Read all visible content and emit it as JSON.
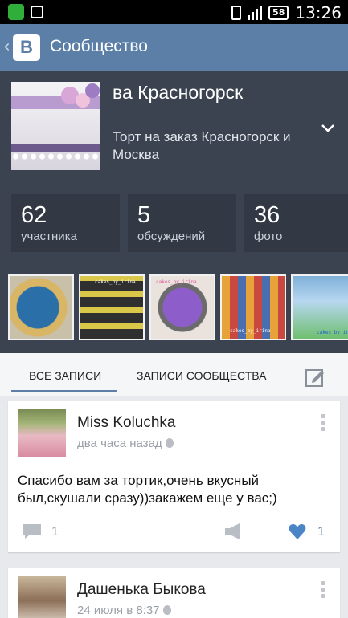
{
  "status_bar": {
    "battery": "58",
    "time": "13:26"
  },
  "app_bar": {
    "logo": "B",
    "title": "Сообщество"
  },
  "group": {
    "name": "ва Красногорск",
    "description": "Торт на заказ Красногорск и Москва"
  },
  "stats": [
    {
      "value": "62",
      "label": "участника"
    },
    {
      "value": "5",
      "label": "обсуждений"
    },
    {
      "value": "36",
      "label": "фото"
    }
  ],
  "photos": [
    {
      "caption": ""
    },
    {
      "caption": "cakes_by_irina"
    },
    {
      "caption": "cakes_by_irina"
    },
    {
      "caption": "cakes_by_irina"
    },
    {
      "caption": "cakes_by_irina"
    }
  ],
  "tabs": {
    "all": "ВСЕ ЗАПИСИ",
    "community": "ЗАПИСИ СООБЩЕСТВА"
  },
  "posts": [
    {
      "author": "Miss Koluchka",
      "time": "два часа назад",
      "text": "Спасибо вам за тортик,очень вкусный был,скушали сразу))закажем еще у вас;)",
      "comments": "1",
      "likes": "1"
    },
    {
      "author": "Дашенька Быкова",
      "time": "24 июля в 8:37"
    }
  ],
  "colors": {
    "accent": "#5b7fa6",
    "header_bg": "#3b4350",
    "like": "#4a86c5"
  }
}
